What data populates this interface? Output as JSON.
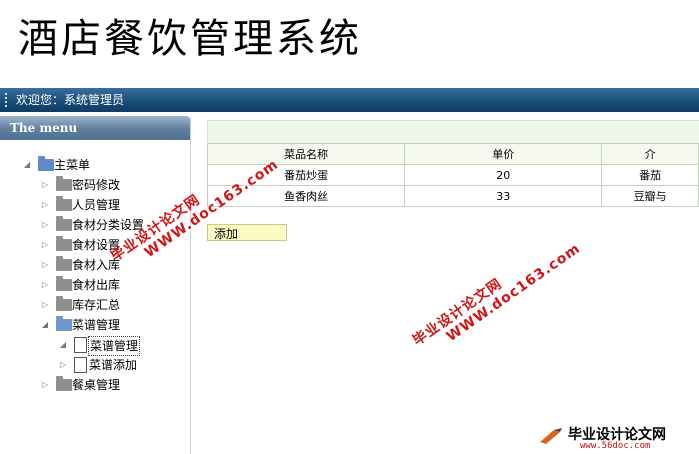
{
  "app": {
    "title": "酒店餐饮管理系统"
  },
  "top_bar": {
    "welcome": "欢迎您：系统管理员"
  },
  "sidebar": {
    "header": "The menu",
    "root": "主菜单",
    "items": [
      {
        "label": "密码修改"
      },
      {
        "label": "人员管理"
      },
      {
        "label": "食材分类设置"
      },
      {
        "label": "食材设置"
      },
      {
        "label": "食材入库"
      },
      {
        "label": "食材出库"
      },
      {
        "label": "库存汇总"
      },
      {
        "label": "菜谱管理",
        "children": [
          "菜谱管理",
          "菜谱添加"
        ]
      },
      {
        "label": "餐桌管理"
      }
    ]
  },
  "table": {
    "columns": [
      "菜品名称",
      "单价",
      "介"
    ],
    "rows": [
      [
        "番茄炒蛋",
        "20",
        "番茄"
      ],
      [
        "鱼香肉丝",
        "33",
        "豆瓣与"
      ]
    ]
  },
  "buttons": {
    "add": "添加"
  },
  "watermark": {
    "line1": "毕业设计论文网",
    "line2": "WWW.doc163.com"
  },
  "corner_logo": {
    "title": "毕业设计论文网",
    "url": "www.56doc.com"
  },
  "colors": {
    "top_bar": "#174b78",
    "sidebar_header": "#5f7f9f",
    "watermark": "#d01616",
    "button_bg": "#fbfbc4"
  }
}
